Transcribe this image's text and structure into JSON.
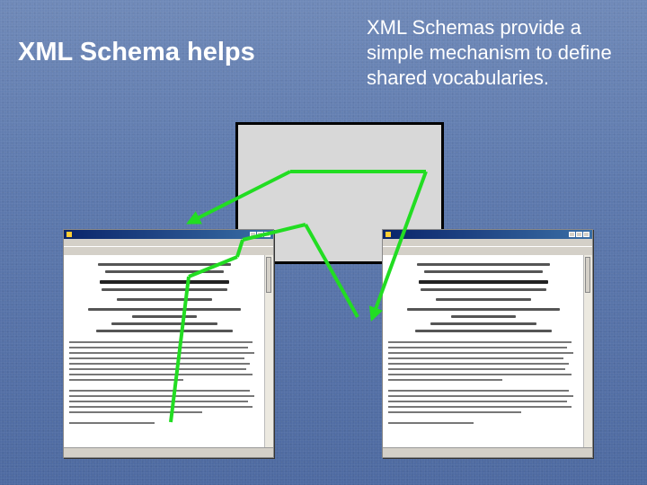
{
  "title": "XML Schema helps",
  "description": "XML Schemas provide a simple mechanism to define shared vocabularies.",
  "colors": {
    "background": "#5d79ad",
    "text": "#ffffff",
    "arrow": "#22dd22",
    "schema_box_fill": "#d8d8d8",
    "schema_box_border": "#000000"
  },
  "icons": [
    "browser-window-icon",
    "arrow-icon"
  ]
}
